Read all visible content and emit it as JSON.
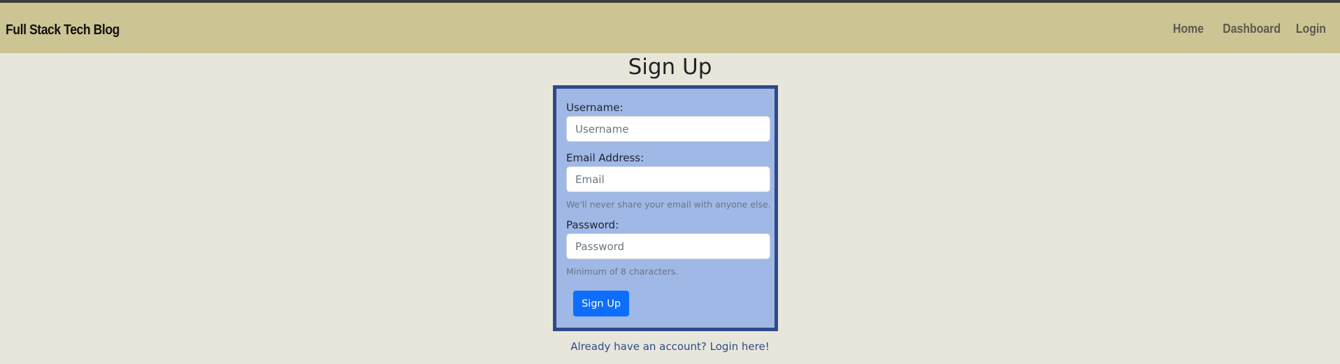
{
  "header": {
    "brand": "Full Stack Tech Blog",
    "nav": [
      {
        "label": "Home"
      },
      {
        "label": "Dashboard"
      },
      {
        "label": "Login"
      }
    ]
  },
  "page": {
    "title": "Sign Up"
  },
  "form": {
    "username": {
      "label": "Username:",
      "placeholder": "Username",
      "value": ""
    },
    "email": {
      "label": "Email Address:",
      "placeholder": "Email",
      "value": "",
      "help": "We'll never share your email with anyone else."
    },
    "password": {
      "label": "Password:",
      "placeholder": "Password",
      "value": "",
      "help": "Minimum of 8 characters."
    },
    "submit_label": "Sign Up"
  },
  "footer": {
    "login_link": "Already have an account? Login here!"
  },
  "colors": {
    "header_bg": "#cdc493",
    "page_bg": "#e8e6db",
    "card_bg": "#9fb8e6",
    "card_border": "#2f4a8a",
    "primary": "#0d6efd",
    "link": "#2d4a89"
  }
}
